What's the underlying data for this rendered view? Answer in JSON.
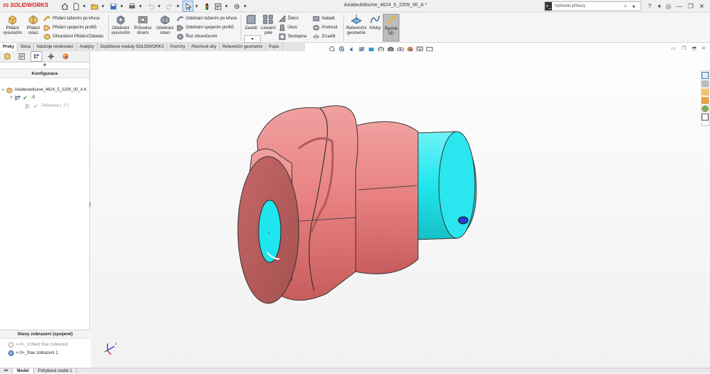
{
  "app": {
    "logo_ds": "3S",
    "logo": "SOLIDWORKS"
  },
  "document_title": "Axialwulstkurve_4624_5_2209_00_A *",
  "search": {
    "terminal": ">_",
    "placeholder": "Vyhledat příkazy"
  },
  "ribbon": {
    "extrude_boss": "Přidání vysunutím",
    "revolve_boss": "Přidání rotací",
    "swept_boss": "Přidání tažením po křivce",
    "lofted_boss": "Přidání spojením profilů",
    "boundary_boss": "Ohraničení Přidání/Základu",
    "extrude_cut": "Odebrání vysunutím",
    "hole_wizard": "Průvodce dírami",
    "revolve_cut": "Odebrání rotací",
    "swept_cut": "Odebrání tažením po křivce",
    "lofted_cut": "Odebrání spojením profilů",
    "boundary_cut": "Řez ohraničením",
    "fillet": "Zaoblit",
    "linear_pattern": "Lineární pole",
    "rib": "Žebro",
    "draft": "Úkos",
    "shell": "Skořepina",
    "wrap": "Nabalit",
    "intersect": "Protnout",
    "mirror": "Zrcadlit",
    "ref_geometry": "Referenční geometrie",
    "curves": "Křivky",
    "instant3d": "Rychlé 3D"
  },
  "tabs": [
    "Prvky",
    "Skica",
    "Nástroje rendrování",
    "Analýzy",
    "Doplňkové moduly SOLIDWORKS",
    "Povrchy",
    "Plechové díly",
    "Referenční geometrie",
    "Popis"
  ],
  "panel": {
    "header": "Konfigurace",
    "tree": {
      "root": "Axialwulstkurve_4624_5_2209_00_A K",
      "config": "-0",
      "child": "Polotovar [ -0 ]"
    },
    "display_states": {
      "header": "Stavy zobrazení (spojené)",
      "item1": "<-0>_Vzhled Stav zobrazení",
      "item2": "<-0>_Stav zobrazení 1"
    },
    "collapse_glyph": "◆"
  },
  "bottom_tabs": [
    "Model",
    "Pohybová studie 1"
  ],
  "colors": {
    "part_red": "#e88080",
    "part_cyan": "#1fe6ee",
    "accent": "#d42027"
  },
  "icons": [
    "home-icon",
    "new-icon",
    "open-icon",
    "save-icon",
    "print-icon",
    "undo-icon",
    "redo-icon",
    "select-icon",
    "rebuild-icon",
    "file-props-icon",
    "options-icon"
  ]
}
